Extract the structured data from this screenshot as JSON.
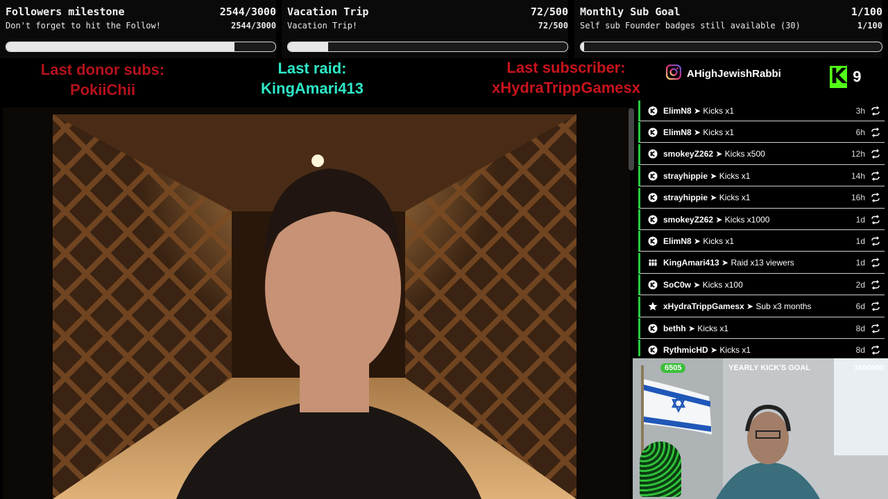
{
  "goals": [
    {
      "title": "Followers milestone",
      "value": "2544/3000",
      "subtitle": "Don't forget to hit the Follow!",
      "progress": 0.848
    },
    {
      "title": "Vacation Trip",
      "value": "72/500",
      "subtitle": "Vacation Trip!",
      "progress": 0.144
    },
    {
      "title": "Monthly Sub Goal",
      "value": "1/100",
      "subtitle": "Self sub Founder badges still available (30)",
      "progress": 0.01
    }
  ],
  "recent": {
    "donor_label": "Last donor subs:",
    "donor_name": "PokiiChii",
    "raid_label": "Last raid:",
    "raid_name": "KingAmari413",
    "sub_label": "Last subscriber:",
    "sub_name": "xHydraTrippGamesx"
  },
  "social": {
    "handle": "AHighJewishRabbi"
  },
  "kick": {
    "logo": "K",
    "count": "9"
  },
  "events": [
    {
      "icon": "kick-icon",
      "user": "ElimN8",
      "action": "Kicks x1",
      "time": "3h"
    },
    {
      "icon": "kick-icon",
      "user": "ElimN8",
      "action": "Kicks x1",
      "time": "6h"
    },
    {
      "icon": "kick-icon",
      "user": "smokeyZ262",
      "action": "Kicks x500",
      "time": "12h"
    },
    {
      "icon": "kick-icon",
      "user": "strayhippie",
      "action": "Kicks x1",
      "time": "14h"
    },
    {
      "icon": "kick-icon",
      "user": "strayhippie",
      "action": "Kicks x1",
      "time": "16h"
    },
    {
      "icon": "kick-icon",
      "user": "smokeyZ262",
      "action": "Kicks x1000",
      "time": "1d"
    },
    {
      "icon": "kick-icon",
      "user": "ElimN8",
      "action": "Kicks x1",
      "time": "1d"
    },
    {
      "icon": "raid-icon",
      "user": "KingAmari413",
      "action": "Raid x13 viewers",
      "time": "1d"
    },
    {
      "icon": "kick-icon",
      "user": "SoC0w",
      "action": "Kicks x100",
      "time": "2d"
    },
    {
      "icon": "star-icon",
      "user": "xHydraTrippGamesx",
      "action": "Sub x3 months",
      "time": "6d"
    },
    {
      "icon": "kick-icon",
      "user": "bethh",
      "action": "Kicks x1",
      "time": "8d"
    },
    {
      "icon": "kick-icon",
      "user": "RythmicHD",
      "action": "Kicks x1",
      "time": "8d"
    }
  ],
  "yearly": {
    "current": "6505",
    "label": "YEARLY KICK'S GOAL",
    "target": "1000000",
    "progress": 0.0065
  },
  "colors": {
    "donor": "#b5121b",
    "raid": "#2ee8c8",
    "subscriber": "#c8141c",
    "kick_green": "#53fc18",
    "event_accent": "#27c93f"
  }
}
